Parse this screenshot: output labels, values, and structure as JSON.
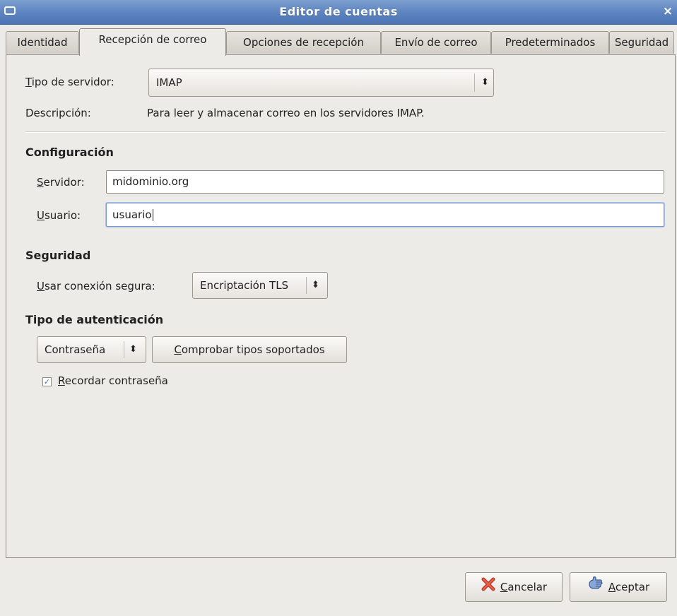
{
  "window": {
    "title": "Editor de cuentas",
    "close_glyph": "×"
  },
  "tabs": [
    {
      "label": "Identidad"
    },
    {
      "label": "Recepción de correo",
      "active": true
    },
    {
      "label": "Opciones de recepción"
    },
    {
      "label": "Envío de correo"
    },
    {
      "label": "Predeterminados"
    },
    {
      "label": "Seguridad"
    }
  ],
  "server_type": {
    "label_mnemonic": "T",
    "label_rest": "ipo de servidor:",
    "value": "IMAP",
    "arrow": "⬍"
  },
  "description": {
    "label": "Descripción:",
    "value": "Para leer y almacenar correo en los servidores IMAP."
  },
  "configuration": {
    "heading": "Configuración",
    "server": {
      "label_mnemonic": "S",
      "label_rest": "ervidor:",
      "value": "midominio.org"
    },
    "user": {
      "label_mnemonic": "U",
      "label_rest": "suario:",
      "value": "usuario"
    }
  },
  "security": {
    "heading": "Seguridad",
    "secure_label_mnemonic": "U",
    "secure_label_rest": "sar conexión segura:",
    "secure_value": "Encriptación TLS",
    "arrow": "⬍"
  },
  "auth": {
    "heading": "Tipo de autenticación",
    "method_value": "Contraseña",
    "arrow": "⬍",
    "check_button_mnemonic": "C",
    "check_button_rest": "omprobar tipos soportados",
    "remember_mnemonic": "R",
    "remember_rest": "ecordar contraseña",
    "remember_checked": true,
    "check_glyph": "✓"
  },
  "footer": {
    "cancel_mnemonic": "C",
    "cancel_rest": "ancelar",
    "accept_mnemonic": "A",
    "accept_rest": "ceptar"
  },
  "icons": {
    "cancel": "cancel-x-icon",
    "accept": "accept-hand-icon",
    "window_menu": "window-menu-icon",
    "close": "close-icon"
  },
  "colors": {
    "titlebar": "#5c83bf",
    "background": "#edebe7",
    "focus_border": "#7a9ad1",
    "cancel_icon": "#c0392b"
  }
}
